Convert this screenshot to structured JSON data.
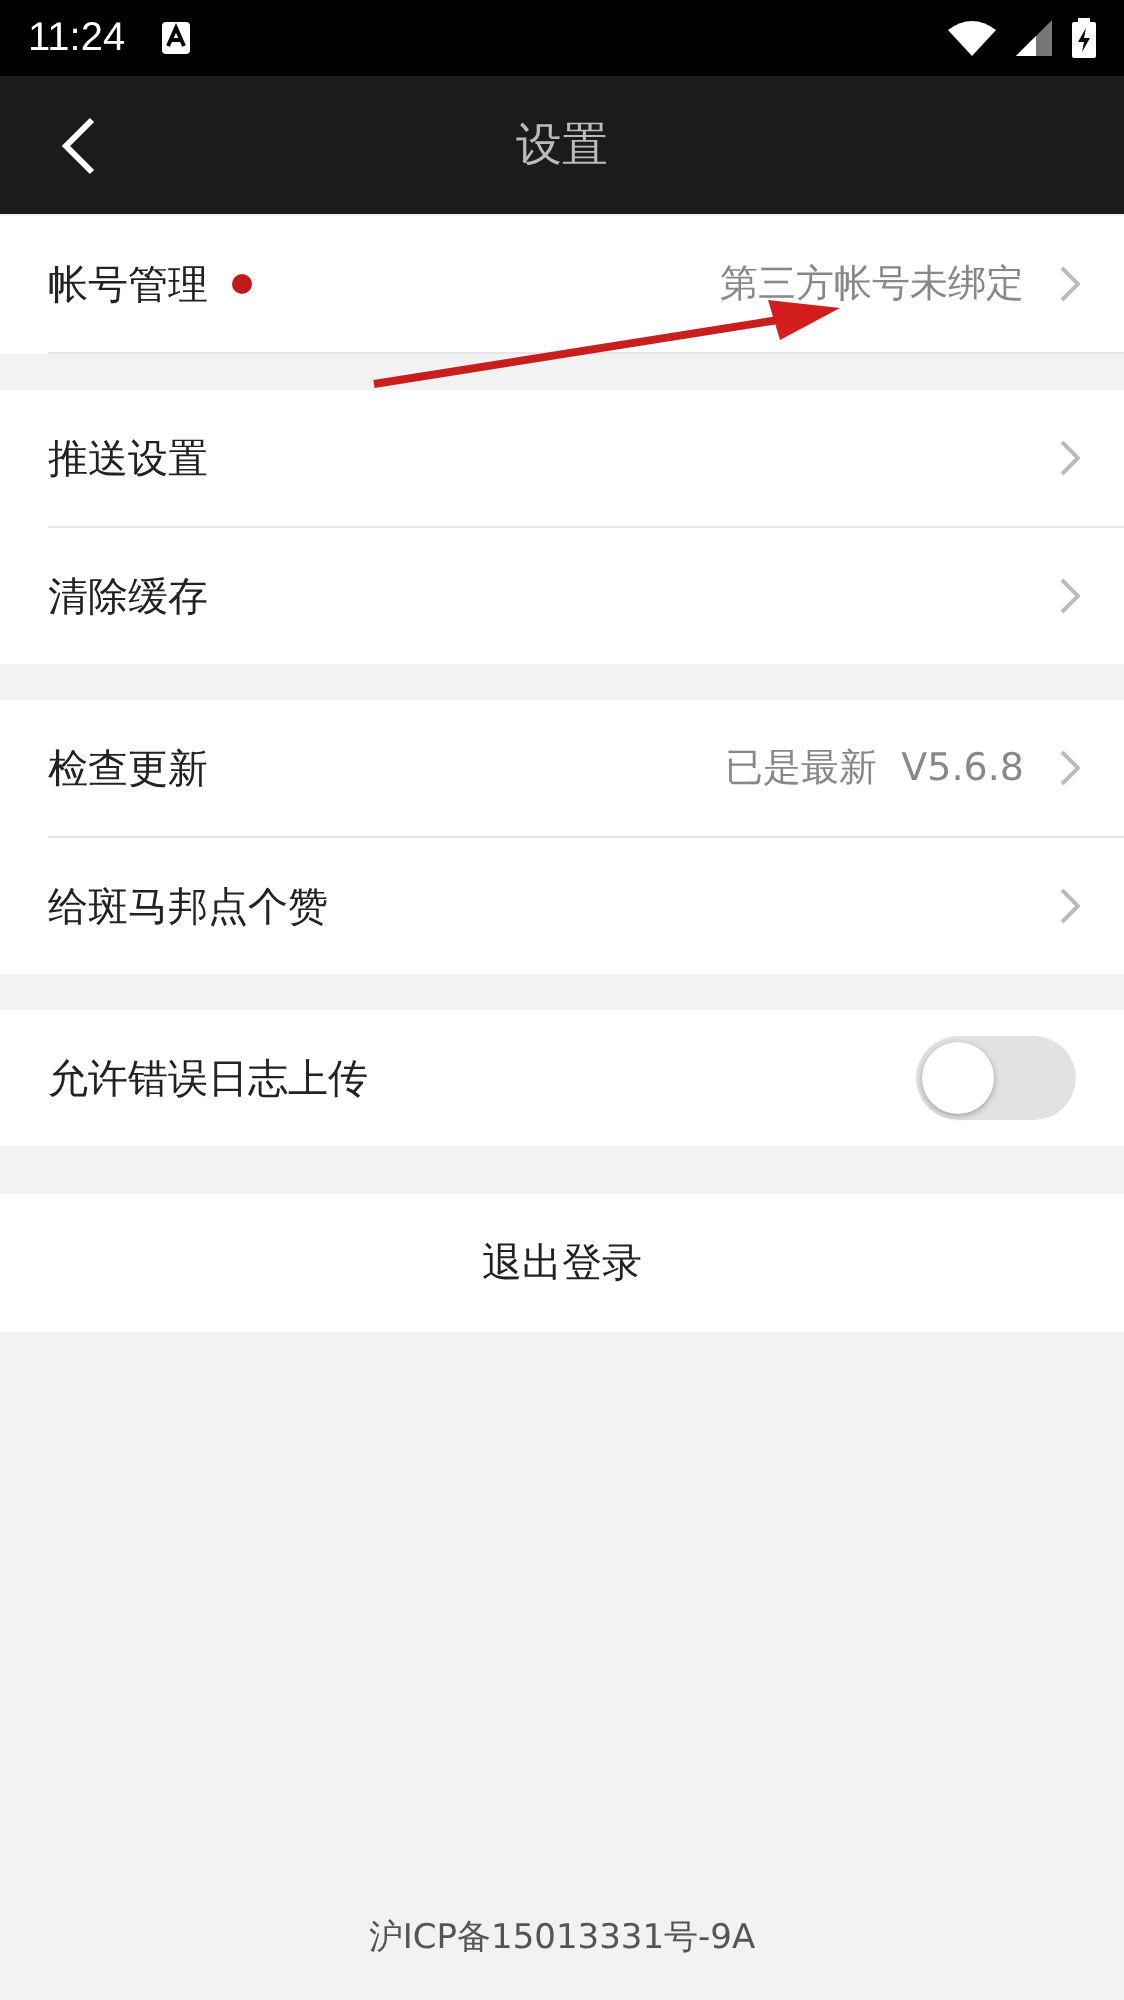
{
  "status_bar": {
    "time": "11:24"
  },
  "nav": {
    "title": "设置"
  },
  "sections": [
    {
      "rows": [
        {
          "kind": "nav",
          "label": "帐号管理",
          "badge": true,
          "value": "第三方帐号未绑定"
        }
      ]
    },
    {
      "rows": [
        {
          "kind": "nav",
          "label": "推送设置",
          "badge": false
        },
        {
          "kind": "nav",
          "label": "清除缓存",
          "badge": false
        }
      ]
    },
    {
      "rows": [
        {
          "kind": "nav",
          "label": "检查更新",
          "badge": false,
          "value": "已是最新  V5.6.8"
        },
        {
          "kind": "nav",
          "label": "给斑马邦点个赞",
          "badge": false
        }
      ]
    },
    {
      "rows": [
        {
          "kind": "toggle",
          "label": "允许错误日志上传",
          "badge": false,
          "on": false
        }
      ]
    }
  ],
  "logout": {
    "label": "退出登录"
  },
  "footer": {
    "text": "沪ICP备15013331号-9A"
  }
}
